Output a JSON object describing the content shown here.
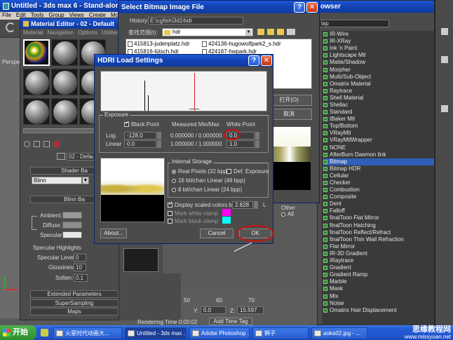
{
  "max_window": {
    "title": "Untitled - 3ds max 6 - Stand-alone Lice",
    "menu": [
      "File",
      "Edit",
      "Tools",
      "Group",
      "Views",
      "Create",
      "Modifier"
    ],
    "viewport_label": "Perspe"
  },
  "material_editor": {
    "title": "Material Editor - 02 - Default",
    "menu": [
      "Material",
      "Navigation",
      "Options",
      "Utilities"
    ],
    "material_name": "02 - Default",
    "shader_rollout": "Shader Ba",
    "shader": "Blinn",
    "blinn_rollout": "Blinn Ba",
    "color_labels": [
      "Ambient:",
      "Diffuse:",
      "Specular:"
    ],
    "specular_title": "Specular Highlights",
    "specular_level_label": "Specular Level:",
    "specular_level": "0",
    "glossiness_label": "Glossiness:",
    "glossiness": "10",
    "soften_label": "Soften:",
    "soften": "0.1",
    "rollouts": [
      "Extended Parameters",
      "SuperSampling",
      "Maps"
    ]
  },
  "browser": {
    "title": "owser",
    "search": "lap",
    "items": [
      "IR-Wire",
      "IR-XRay",
      "Ink 'n Paint",
      "Lightscape Mtl",
      "Matte/Shadow",
      "Morpher",
      "Multi/Sub-Object",
      "Omatrix Material",
      "Raytrace",
      "Shell Material",
      "Shellac",
      "Standard",
      "tBaker Mtl",
      "Top/Bottom",
      "VRayMtl",
      "VRayMtlWrapper",
      "NONE",
      "AfterBurn Daemon link",
      "Bitmap",
      "Bitmap HDR",
      "Cellular",
      "Checker",
      "Combustion",
      "Composite",
      "Dent",
      "Falloff",
      "finalToon Flat Mirror",
      "finalToon Hatching",
      "finalToon Reflect/Refract",
      "finalToon Thin Wall Refraction",
      "Flat Mirror",
      "IR-3D Gradient",
      "IRaytrace",
      "Gradient",
      "Gradient Ramp",
      "Marble",
      "Mask",
      "Mix",
      "Noise",
      "Omatrix Hair Displacement"
    ],
    "selected": "Bitmap",
    "other_label": "Other",
    "all_label": "All"
  },
  "select_bitmap": {
    "title": "Select Bitmap Image File",
    "history_label": "History:",
    "history_path": "E:\\cgfish\\3d1\\hdr",
    "lookin_label": "查找范围(I):",
    "lookin_value": "hdr",
    "files": [
      "415813-judenplatz.hdr",
      "415816-lütsch.hdr",
      "424136-hugowolfpark2_s.hdr",
      "424167-hwpark.hdr"
    ],
    "open_button": "打开(O)",
    "cancel_button": "取消"
  },
  "hdri_dialog": {
    "title": "HDRI Load Settings",
    "exposure_label": "Exposure",
    "black_point_label": "Black Point",
    "measured_label": "Measured Min/Max",
    "white_point_label": "White Point",
    "log_label": "Log.",
    "linear_label": "Linear",
    "black_log": "-128.0",
    "black_linear": "0.0",
    "measured_log": "0.000000 / 0.000000",
    "measured_linear": "1.000000 / 1.000000",
    "white_log": "0.0",
    "white_linear": "1.0",
    "internal_storage_label": "Internal Storage",
    "storage_options": [
      "Real Pixels (32 bpp)",
      "16 bit/chan Linear (48 bpp)",
      "8 bit/chan Linear (24 bpp)"
    ],
    "def_exposure_label": "Def. Exposure",
    "display_scaled_label": "Display scaled colors by:",
    "display_scaled_value": "2.828",
    "l_label": "L",
    "mark_white_label": "Mark white clamp",
    "mark_black_label": "Mark black clamp",
    "white_clamp_color": "#ff00ff",
    "black_clamp_color": "#00ffff",
    "about_button": "About...",
    "cancel_button": "Cancel",
    "ok_button": "OK"
  },
  "status": {
    "rendering_time": "Rendering Time  0:00:02",
    "add_time_tag": "Add Time Tag",
    "y_label": "Y:",
    "y_value": "0.0",
    "z_label": "Z:",
    "z_value": "15.597",
    "ruler": [
      "50",
      "60",
      "70"
    ]
  },
  "taskbar": {
    "start_label": "开始",
    "buttons": [
      "火星时代动画大...",
      "Untitled - 3ds max ...",
      "Adobe Photoshop ...",
      "狮子",
      "aoka02.jpg - ..."
    ],
    "watermark_top": "思缘教程网",
    "watermark_bottom": "www.missyuan.net"
  }
}
